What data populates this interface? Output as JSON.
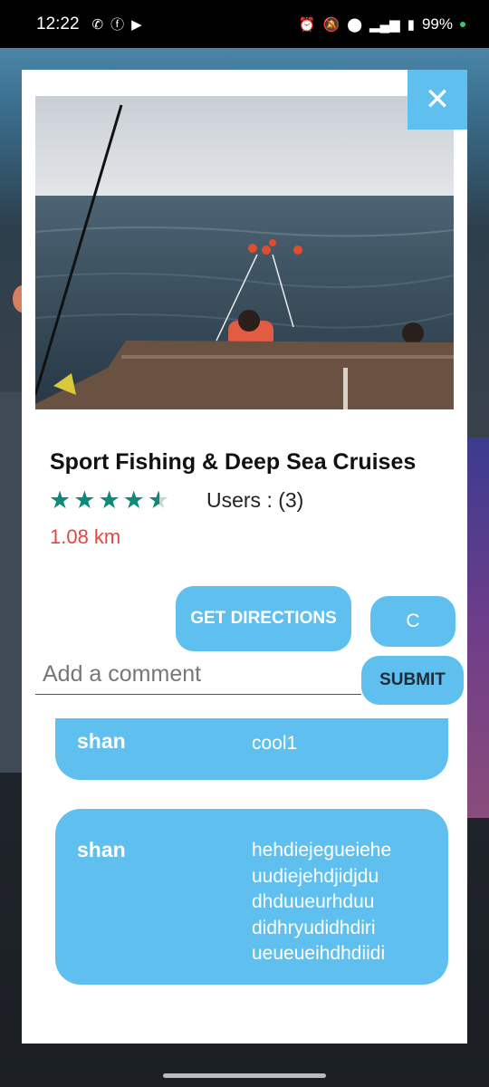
{
  "status_bar": {
    "time": "12:22",
    "battery": "99%"
  },
  "place": {
    "title": "Sport Fishing & Deep Sea Cruises",
    "rating": 4.5,
    "users_label": "Users : (3)",
    "distance": "1.08 km"
  },
  "actions": {
    "directions_label": "GET DIRECTIONS",
    "c_label": "C",
    "submit_label": "SUBMIT"
  },
  "comment_input": {
    "placeholder": "Add a comment"
  },
  "comments": [
    {
      "user": "shan",
      "text": "cool1"
    },
    {
      "user": "shan",
      "text": "hehdiejegueiehe uudiejehdjidjdu dhduueurhduu didhryudidhdiri ueueueihdhdiidi"
    }
  ],
  "colors": {
    "accent": "#5fc0ef",
    "star": "#11897a",
    "distance": "#e2483f"
  },
  "icons": {
    "close": "close-icon",
    "star": "star-icon"
  }
}
